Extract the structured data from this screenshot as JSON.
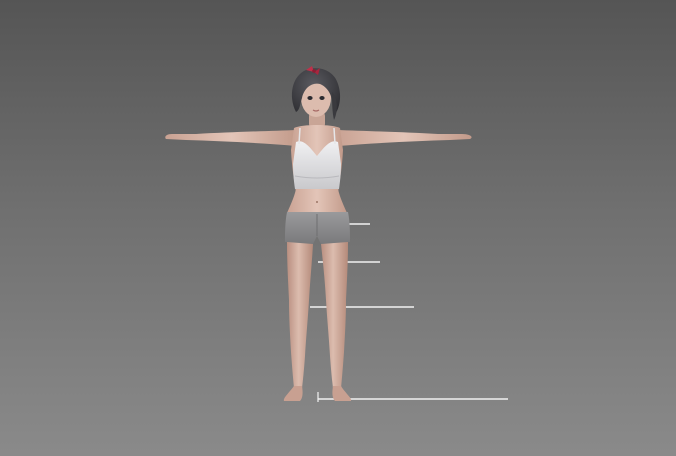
{
  "viewport": {
    "background_top": "#555555",
    "background_bottom": "#8a8a8a"
  },
  "model": {
    "skin_color": "#d9b8aa",
    "skin_shadow": "#b89080",
    "hair_color": "#3e3e42",
    "bow_color": "#c0304a",
    "top_color": "#e6e6e8",
    "shorts_color": "#8c8c8e"
  },
  "guides": {
    "line_color": "#f2f2f2",
    "count": 4
  }
}
